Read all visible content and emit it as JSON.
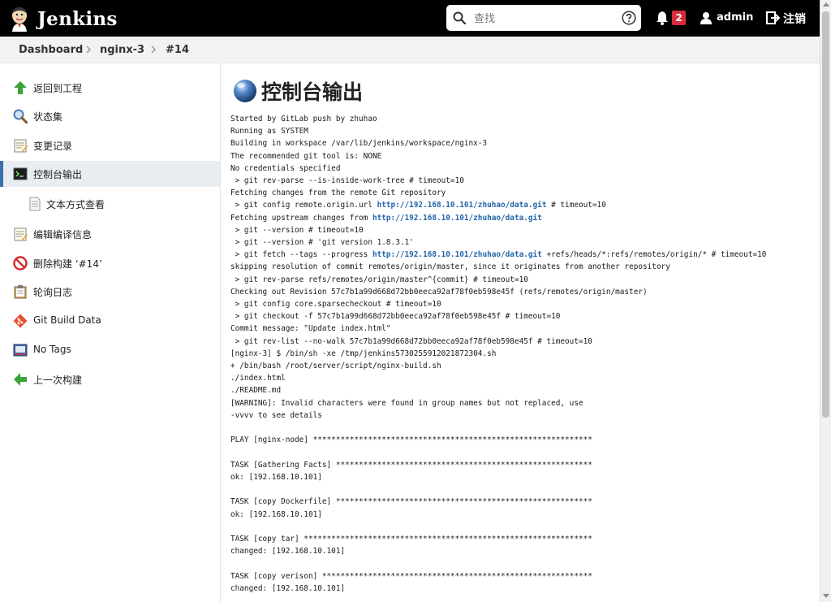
{
  "header": {
    "brand": "Jenkins",
    "search_placeholder": "查找",
    "notification_count": "2",
    "user": "admin",
    "logout": "注销"
  },
  "breadcrumb": [
    "Dashboard",
    "nginx-3",
    "#14"
  ],
  "sidebar": {
    "items": [
      {
        "label": "返回到工程",
        "icon": "up-arrow-icon"
      },
      {
        "label": "状态集",
        "icon": "magnifier-icon"
      },
      {
        "label": "变更记录",
        "icon": "notepad-icon"
      },
      {
        "label": "控制台输出",
        "icon": "terminal-icon",
        "active": true
      },
      {
        "label": "文本方式查看",
        "icon": "document-icon",
        "sub": true
      },
      {
        "label": "编辑编译信息",
        "icon": "notepad-icon"
      },
      {
        "label": "删除构建 ‘#14’",
        "icon": "no-entry-icon"
      },
      {
        "label": "轮询日志",
        "icon": "clipboard-icon"
      },
      {
        "label": "Git Build Data",
        "icon": "git-icon"
      },
      {
        "label": "No Tags",
        "icon": "tag-icon"
      },
      {
        "label": "上一次构建",
        "icon": "left-arrow-icon"
      }
    ]
  },
  "main": {
    "title": "控制台输出",
    "console": [
      {
        "text": "Started by GitLab push by zhuhao"
      },
      {
        "text": "Running as SYSTEM"
      },
      {
        "text": "Building in workspace /var/lib/jenkins/workspace/nginx-3"
      },
      {
        "text": "The recommended git tool is: NONE"
      },
      {
        "text": "No credentials specified"
      },
      {
        "text": " > git rev-parse --is-inside-work-tree # timeout=10"
      },
      {
        "text": "Fetching changes from the remote Git repository"
      },
      {
        "text": " > git config remote.origin.url ",
        "link": "http://192.168.10.101/zhuhao/data.git",
        "after": " # timeout=10"
      },
      {
        "text": "Fetching upstream changes from ",
        "link": "http://192.168.10.101/zhuhao/data.git",
        "after": ""
      },
      {
        "text": " > git --version # timeout=10"
      },
      {
        "text": " > git --version # 'git version 1.8.3.1'"
      },
      {
        "text": " > git fetch --tags --progress ",
        "link": "http://192.168.10.101/zhuhao/data.git",
        "after": " +refs/heads/*:refs/remotes/origin/* # timeout=10"
      },
      {
        "text": "skipping resolution of commit remotes/origin/master, since it originates from another repository"
      },
      {
        "text": " > git rev-parse refs/remotes/origin/master^{commit} # timeout=10"
      },
      {
        "text": "Checking out Revision 57c7b1a99d668d72bb0eeca92af78f0eb598e45f (refs/remotes/origin/master)"
      },
      {
        "text": " > git config core.sparsecheckout # timeout=10"
      },
      {
        "text": " > git checkout -f 57c7b1a99d668d72bb0eeca92af78f0eb598e45f # timeout=10"
      },
      {
        "text": "Commit message: \"Update index.html\""
      },
      {
        "text": " > git rev-list --no-walk 57c7b1a99d668d72bb0eeca92af78f0eb598e45f # timeout=10"
      },
      {
        "text": "[nginx-3] $ /bin/sh -xe /tmp/jenkins5730255912021872304.sh"
      },
      {
        "text": "+ /bin/bash /root/server/script/nginx-build.sh"
      },
      {
        "text": "./index.html"
      },
      {
        "text": "./README.md"
      },
      {
        "text": "[WARNING]: Invalid characters were found in group names but not replaced, use"
      },
      {
        "text": "-vvvv to see details"
      },
      {
        "text": ""
      },
      {
        "text": "PLAY [nginx-node] *************************************************************"
      },
      {
        "text": ""
      },
      {
        "text": "TASK [Gathering Facts] ********************************************************"
      },
      {
        "text": "ok: [192.168.10.101]"
      },
      {
        "text": ""
      },
      {
        "text": "TASK [copy Dockerfile] ********************************************************"
      },
      {
        "text": "ok: [192.168.10.101]"
      },
      {
        "text": ""
      },
      {
        "text": "TASK [copy tar] ***************************************************************"
      },
      {
        "text": "changed: [192.168.10.101]"
      },
      {
        "text": ""
      },
      {
        "text": "TASK [copy verison] ***********************************************************"
      },
      {
        "text": "changed: [192.168.10.101]"
      }
    ]
  },
  "colors": {
    "header_bg": "#000000",
    "badge": "#d72d3b",
    "link": "#2266aa",
    "active_item_bg": "#e7edf1",
    "active_border": "#3a6fa8"
  }
}
